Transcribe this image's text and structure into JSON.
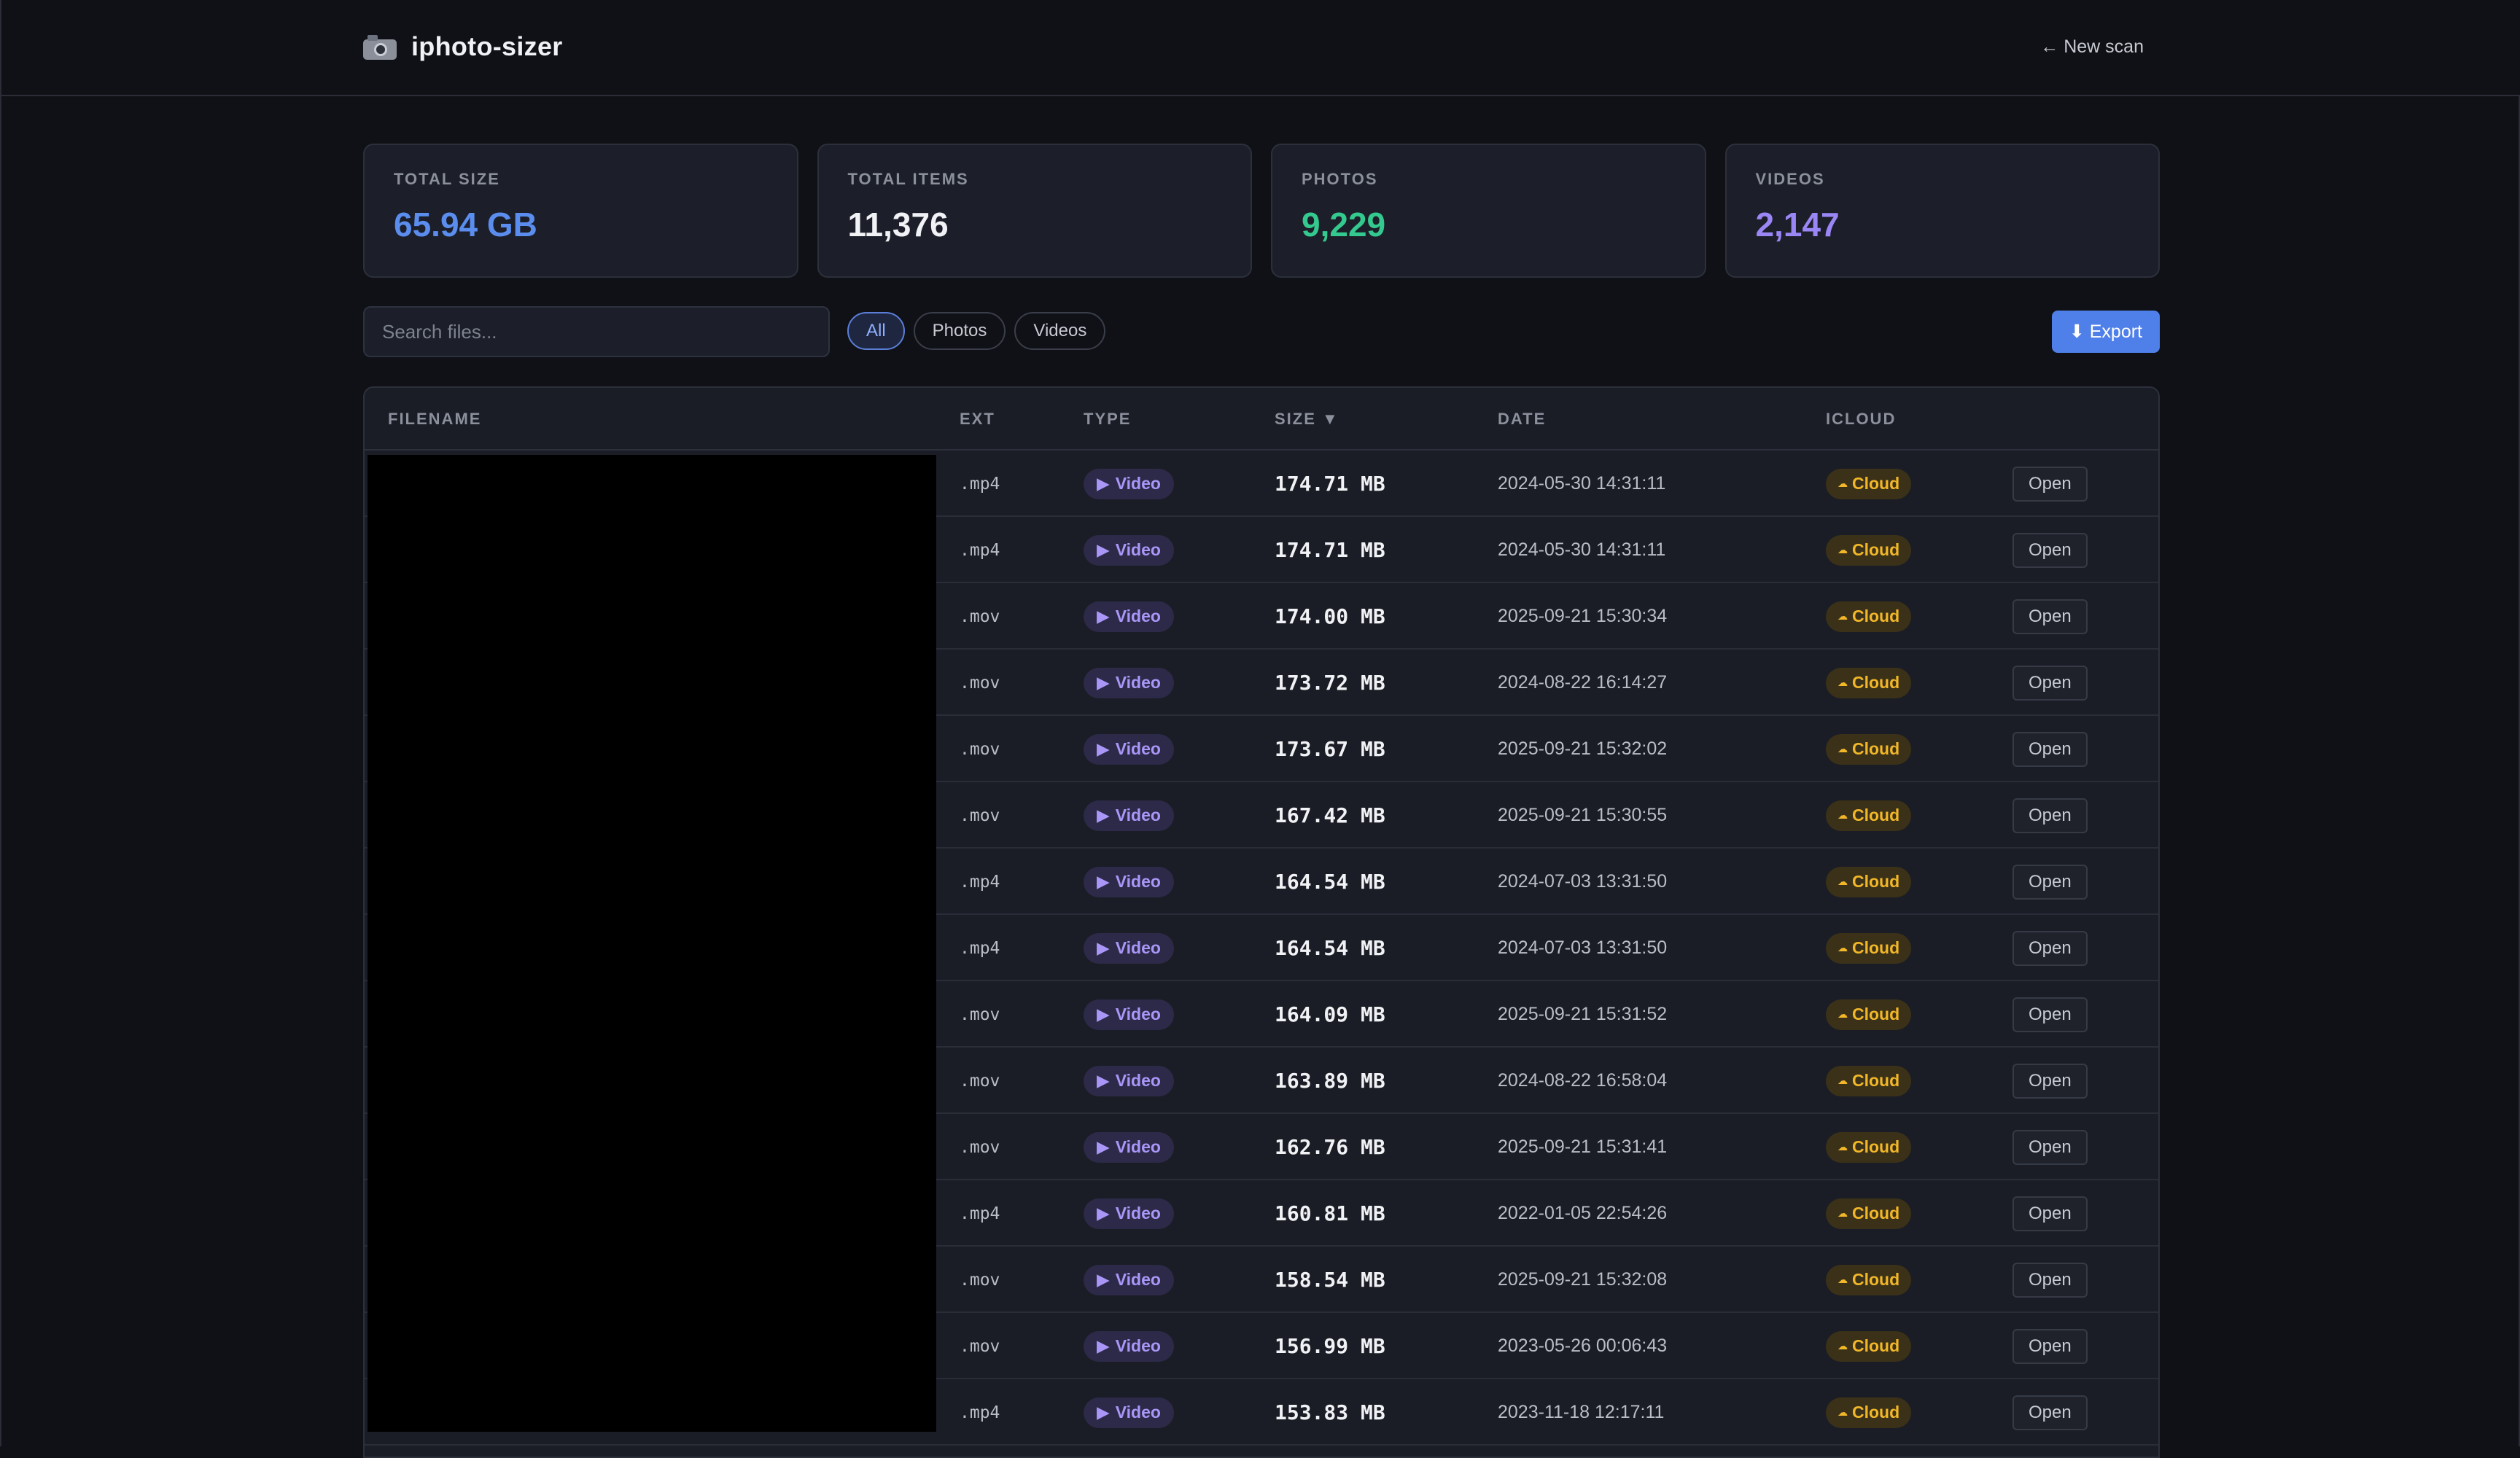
{
  "app": {
    "name": "iphoto-sizer",
    "icon": "camera-icon",
    "new_scan_label": "← New scan"
  },
  "stats": [
    {
      "label": "TOTAL SIZE",
      "value": "65.94 GB",
      "color": "#5b8def"
    },
    {
      "label": "TOTAL ITEMS",
      "value": "11,376",
      "color": "#f1f2f5"
    },
    {
      "label": "PHOTOS",
      "value": "9,229",
      "color": "#34c98e"
    },
    {
      "label": "VIDEOS",
      "value": "2,147",
      "color": "#9b86f5"
    }
  ],
  "search": {
    "placeholder": "Search files..."
  },
  "filters": {
    "all": "All",
    "photos": "Photos",
    "videos": "Videos",
    "active": "All"
  },
  "export_label": "⬇ Export",
  "table": {
    "headers": {
      "filename": "FILENAME",
      "ext": "EXT",
      "type": "TYPE",
      "size": "SIZE ▼",
      "date": "DATE",
      "icloud": "ICLOUD"
    },
    "rows": [
      {
        "ext": ".mp4",
        "type": "Video",
        "size": "174.71 MB",
        "date": "2024-05-30 14:31:11",
        "icloud": "Cloud",
        "action": "Open"
      },
      {
        "ext": ".mp4",
        "type": "Video",
        "size": "174.71 MB",
        "date": "2024-05-30 14:31:11",
        "icloud": "Cloud",
        "action": "Open"
      },
      {
        "ext": ".mov",
        "type": "Video",
        "size": "174.00 MB",
        "date": "2025-09-21 15:30:34",
        "icloud": "Cloud",
        "action": "Open"
      },
      {
        "ext": ".mov",
        "type": "Video",
        "size": "173.72 MB",
        "date": "2024-08-22 16:14:27",
        "icloud": "Cloud",
        "action": "Open"
      },
      {
        "ext": ".mov",
        "type": "Video",
        "size": "173.67 MB",
        "date": "2025-09-21 15:32:02",
        "icloud": "Cloud",
        "action": "Open"
      },
      {
        "ext": ".mov",
        "type": "Video",
        "size": "167.42 MB",
        "date": "2025-09-21 15:30:55",
        "icloud": "Cloud",
        "action": "Open"
      },
      {
        "ext": ".mp4",
        "type": "Video",
        "size": "164.54 MB",
        "date": "2024-07-03 13:31:50",
        "icloud": "Cloud",
        "action": "Open"
      },
      {
        "ext": ".mp4",
        "type": "Video",
        "size": "164.54 MB",
        "date": "2024-07-03 13:31:50",
        "icloud": "Cloud",
        "action": "Open"
      },
      {
        "ext": ".mov",
        "type": "Video",
        "size": "164.09 MB",
        "date": "2025-09-21 15:31:52",
        "icloud": "Cloud",
        "action": "Open"
      },
      {
        "ext": ".mov",
        "type": "Video",
        "size": "163.89 MB",
        "date": "2024-08-22 16:58:04",
        "icloud": "Cloud",
        "action": "Open"
      },
      {
        "ext": ".mov",
        "type": "Video",
        "size": "162.76 MB",
        "date": "2025-09-21 15:31:41",
        "icloud": "Cloud",
        "action": "Open"
      },
      {
        "ext": ".mp4",
        "type": "Video",
        "size": "160.81 MB",
        "date": "2022-01-05 22:54:26",
        "icloud": "Cloud",
        "action": "Open"
      },
      {
        "ext": ".mov",
        "type": "Video",
        "size": "158.54 MB",
        "date": "2025-09-21 15:32:08",
        "icloud": "Cloud",
        "action": "Open"
      },
      {
        "ext": ".mov",
        "type": "Video",
        "size": "156.99 MB",
        "date": "2023-05-26 00:06:43",
        "icloud": "Cloud",
        "action": "Open"
      },
      {
        "ext": ".mp4",
        "type": "Video",
        "size": "153.83 MB",
        "date": "2023-11-18 12:17:11",
        "icloud": "Cloud",
        "action": "Open"
      }
    ]
  }
}
